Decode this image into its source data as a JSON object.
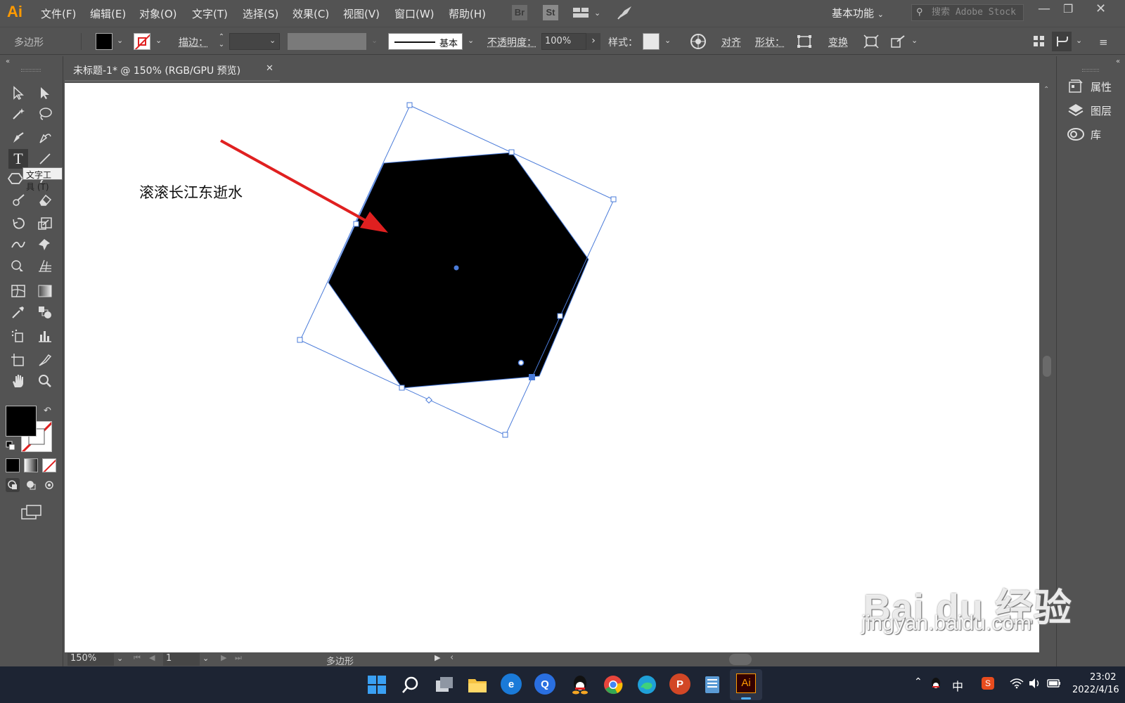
{
  "app": {
    "logo": "Ai",
    "menus": [
      "文件(F)",
      "编辑(E)",
      "对象(O)",
      "文字(T)",
      "选择(S)",
      "效果(C)",
      "视图(V)",
      "窗口(W)",
      "帮助(H)"
    ],
    "bridge_label": "Br",
    "stock_label": "St",
    "workspace": "基本功能",
    "search_placeholder": "搜索 Adobe Stock"
  },
  "controlbar": {
    "selection_type": "多边形",
    "stroke_label": "描边：",
    "stroke_profile": "基本",
    "opacity_label": "不透明度：",
    "opacity_value": "100%",
    "style_label": "样式：",
    "align_label": "对齐",
    "shape_label": "形状：",
    "transform_label": "变换",
    "fill_color": "#000000"
  },
  "document": {
    "tab_title": "未标题-1* @ 150% (RGB/GPU 预览)",
    "canvas_text": "滚滚长江东逝水",
    "shape_fill": "#000000",
    "selection_color": "#4a7bd9",
    "arrow_color": "#e02020"
  },
  "toolpanel": {
    "tooltip": "文字工具 (T)"
  },
  "rightpanel": {
    "items": [
      "属性",
      "图层",
      "库"
    ]
  },
  "status": {
    "zoom": "150%",
    "artboard": "1",
    "selection": "多边形"
  },
  "taskbar": {
    "time": "23:02",
    "date": "2022/4/16",
    "ime": "中"
  },
  "watermark": {
    "logo": "Bai du 经验",
    "url": "jingyan.baidu.com"
  }
}
